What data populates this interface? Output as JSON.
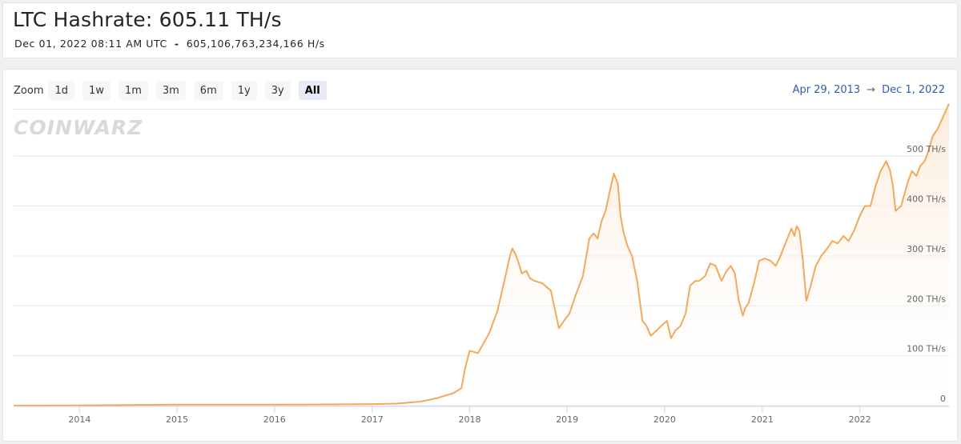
{
  "header": {
    "title": "LTC Hashrate: 605.11 TH/s",
    "timestamp": "Dec 01, 2022 08:11 AM UTC",
    "separator": "-",
    "raw_hashrate": "605,106,763,234,166 H/s"
  },
  "zoom": {
    "label": "Zoom",
    "buttons": [
      "1d",
      "1w",
      "1m",
      "3m",
      "6m",
      "1y",
      "3y",
      "All"
    ],
    "active": "All"
  },
  "range": {
    "from": "Apr 29, 2013",
    "arrow": "→",
    "to": "Dec 1, 2022"
  },
  "watermark": "COINWARZ",
  "colors": {
    "line": "#f4a95a",
    "fill_top": "#fbe9d7",
    "grid": "#e6e6e6",
    "axis_text": "#666666",
    "range_text": "#335cad"
  },
  "chart_data": {
    "type": "area",
    "series": [
      {
        "x": [
          "2013-04-29",
          "2014-01-01",
          "2015-01-01",
          "2016-01-01",
          "2017-01-01",
          "2017-04-01",
          "2017-07-01",
          "2017-09-01",
          "2017-11-01",
          "2017-12-01",
          "2017-12-15",
          "2018-01-01",
          "2018-02-01",
          "2018-03-15",
          "2018-04-15",
          "2018-05-15",
          "2018-06-01",
          "2018-06-10",
          "2018-06-20",
          "2018-07-01",
          "2018-07-15",
          "2018-08-01",
          "2018-08-15",
          "2018-09-01",
          "2018-10-01",
          "2018-11-01",
          "2018-12-01",
          "2018-12-20",
          "2019-01-10",
          "2019-02-01",
          "2019-03-01",
          "2019-03-25",
          "2019-04-10",
          "2019-04-25",
          "2019-05-10",
          "2019-05-25",
          "2019-06-10",
          "2019-06-25",
          "2019-07-10",
          "2019-07-20",
          "2019-08-01",
          "2019-08-15",
          "2019-09-01",
          "2019-09-20",
          "2019-10-10",
          "2019-10-25",
          "2019-11-10",
          "2019-12-01",
          "2019-12-20",
          "2020-01-10",
          "2020-01-25",
          "2020-02-10",
          "2020-03-01",
          "2020-03-20",
          "2020-04-05",
          "2020-04-25",
          "2020-05-10",
          "2020-06-01",
          "2020-06-20",
          "2020-07-10",
          "2020-08-01",
          "2020-08-20",
          "2020-09-05",
          "2020-09-20",
          "2020-10-05",
          "2020-10-20",
          "2020-10-28",
          "2020-11-10",
          "2020-12-01",
          "2020-12-20",
          "2021-01-10",
          "2021-02-01",
          "2021-02-20",
          "2021-03-10",
          "2021-04-01",
          "2021-04-20",
          "2021-05-01",
          "2021-05-10",
          "2021-05-20",
          "2021-06-01",
          "2021-06-15",
          "2021-07-01",
          "2021-07-20",
          "2021-08-10",
          "2021-09-01",
          "2021-09-20",
          "2021-10-10",
          "2021-11-01",
          "2021-11-20",
          "2021-12-10",
          "2022-01-01",
          "2022-01-20",
          "2022-02-10",
          "2022-03-01",
          "2022-03-20",
          "2022-04-10",
          "2022-04-25",
          "2022-05-05",
          "2022-05-15",
          "2022-05-25",
          "2022-06-05",
          "2022-06-15",
          "2022-07-01",
          "2022-07-15",
          "2022-08-01",
          "2022-08-15",
          "2022-09-01",
          "2022-09-15",
          "2022-10-01",
          "2022-10-20",
          "2022-11-10",
          "2022-12-01"
        ],
        "y": [
          0,
          0.5,
          2,
          2,
          3,
          4,
          8,
          15,
          25,
          35,
          75,
          110,
          105,
          145,
          190,
          260,
          300,
          315,
          305,
          290,
          265,
          270,
          255,
          250,
          245,
          230,
          155,
          170,
          185,
          220,
          260,
          335,
          345,
          335,
          370,
          390,
          430,
          465,
          445,
          380,
          345,
          320,
          300,
          250,
          170,
          160,
          140,
          150,
          160,
          170,
          135,
          150,
          160,
          185,
          240,
          250,
          250,
          260,
          285,
          280,
          250,
          270,
          280,
          265,
          210,
          180,
          195,
          205,
          245,
          290,
          295,
          290,
          280,
          300,
          330,
          355,
          340,
          360,
          350,
          295,
          210,
          240,
          280,
          300,
          315,
          330,
          325,
          340,
          330,
          350,
          380,
          400,
          400,
          440,
          470,
          490,
          470,
          440,
          390,
          395,
          400,
          420,
          450,
          470,
          460,
          480,
          490,
          510,
          540,
          555,
          580,
          605
        ]
      }
    ],
    "y_ticks": [
      "0",
      "100 TH/s",
      "200 TH/s",
      "300 TH/s",
      "400 TH/s",
      "500 TH/s"
    ],
    "y_tick_values": [
      0,
      100,
      200,
      300,
      400,
      500
    ],
    "x_ticks": [
      "2014",
      "2015",
      "2016",
      "2017",
      "2018",
      "2019",
      "2020",
      "2021",
      "2022"
    ],
    "ylim": [
      0,
      590
    ],
    "xlim": [
      "2013-04-29",
      "2022-12-01"
    ],
    "grid": "horizontal",
    "y_axis_side": "right",
    "legend": "none"
  }
}
